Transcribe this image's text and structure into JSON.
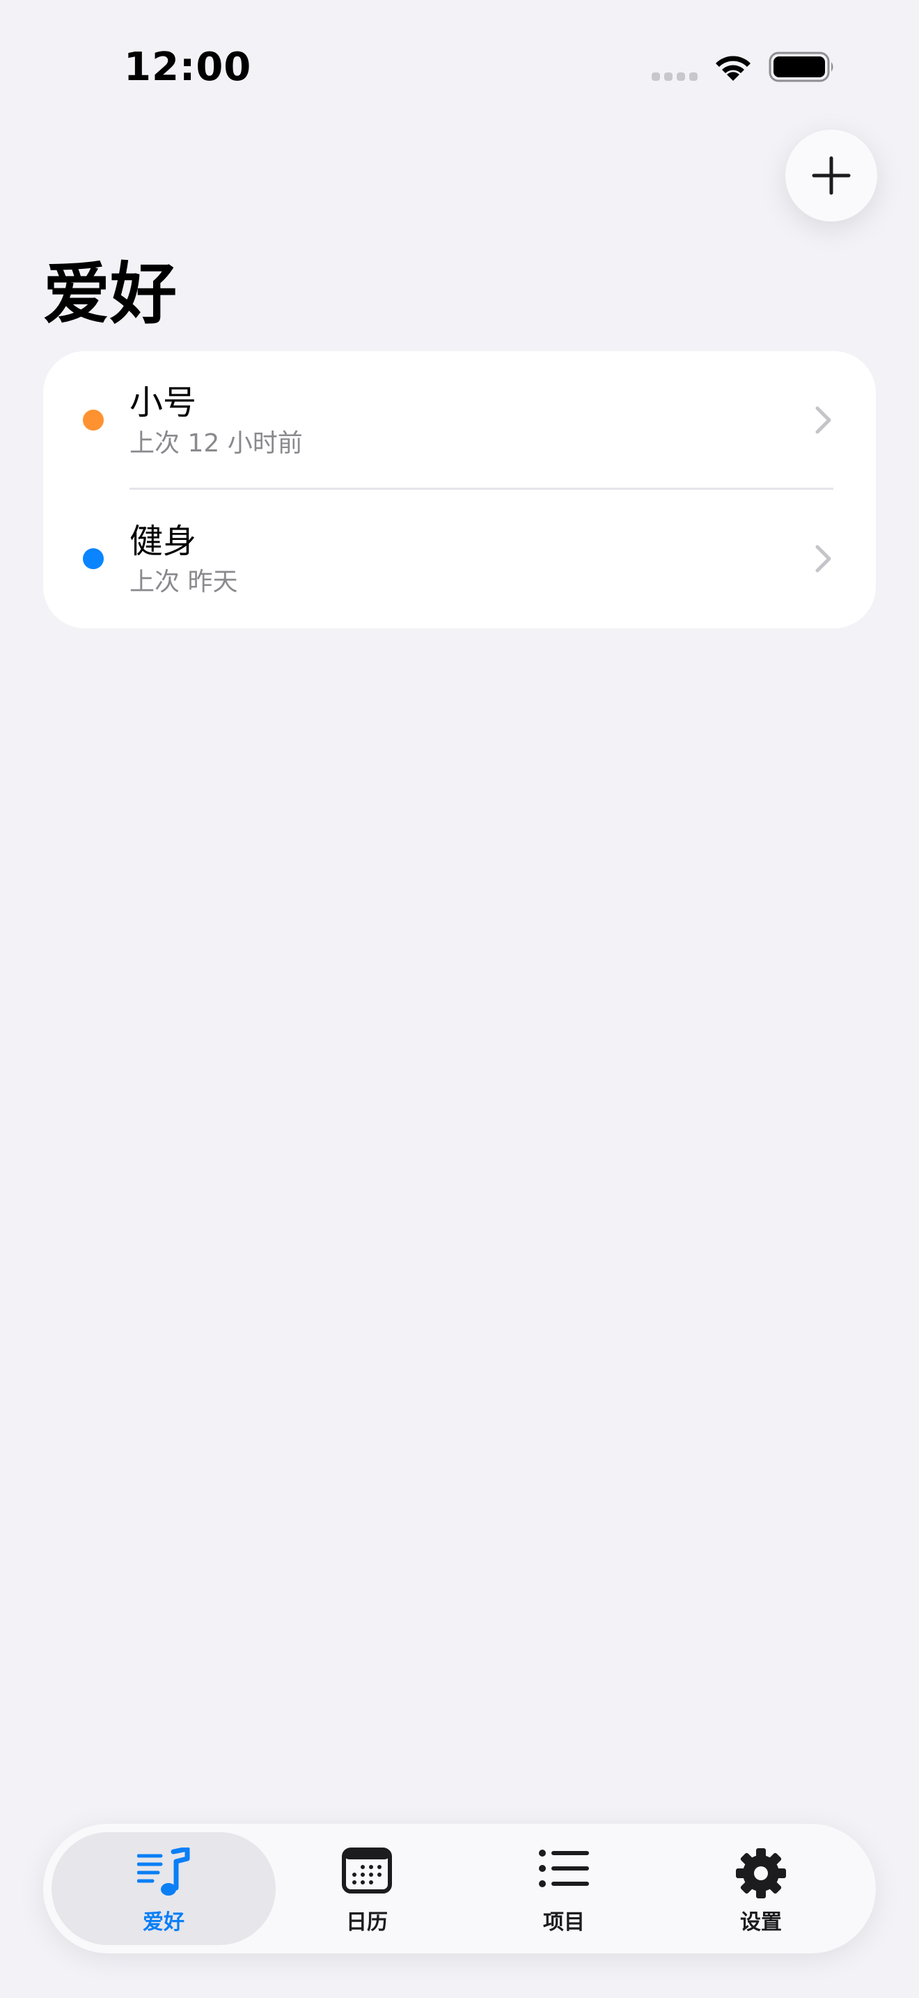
{
  "status_bar": {
    "time": "12:00"
  },
  "header": {
    "title": "爱好"
  },
  "hobbies": [
    {
      "name": "小号",
      "last": "上次 12 小时前",
      "color": "#ff9230"
    },
    {
      "name": "健身",
      "last": "上次 昨天",
      "color": "#0a84ff"
    }
  ],
  "tabs": [
    {
      "label": "爱好",
      "icon": "music-list-icon",
      "active": true
    },
    {
      "label": "日历",
      "icon": "calendar-icon",
      "active": false
    },
    {
      "label": "项目",
      "icon": "list-icon",
      "active": false
    },
    {
      "label": "设置",
      "icon": "gear-icon",
      "active": false
    }
  ],
  "colors": {
    "accent": "#0a7ff5",
    "background": "#f2f2f7"
  }
}
